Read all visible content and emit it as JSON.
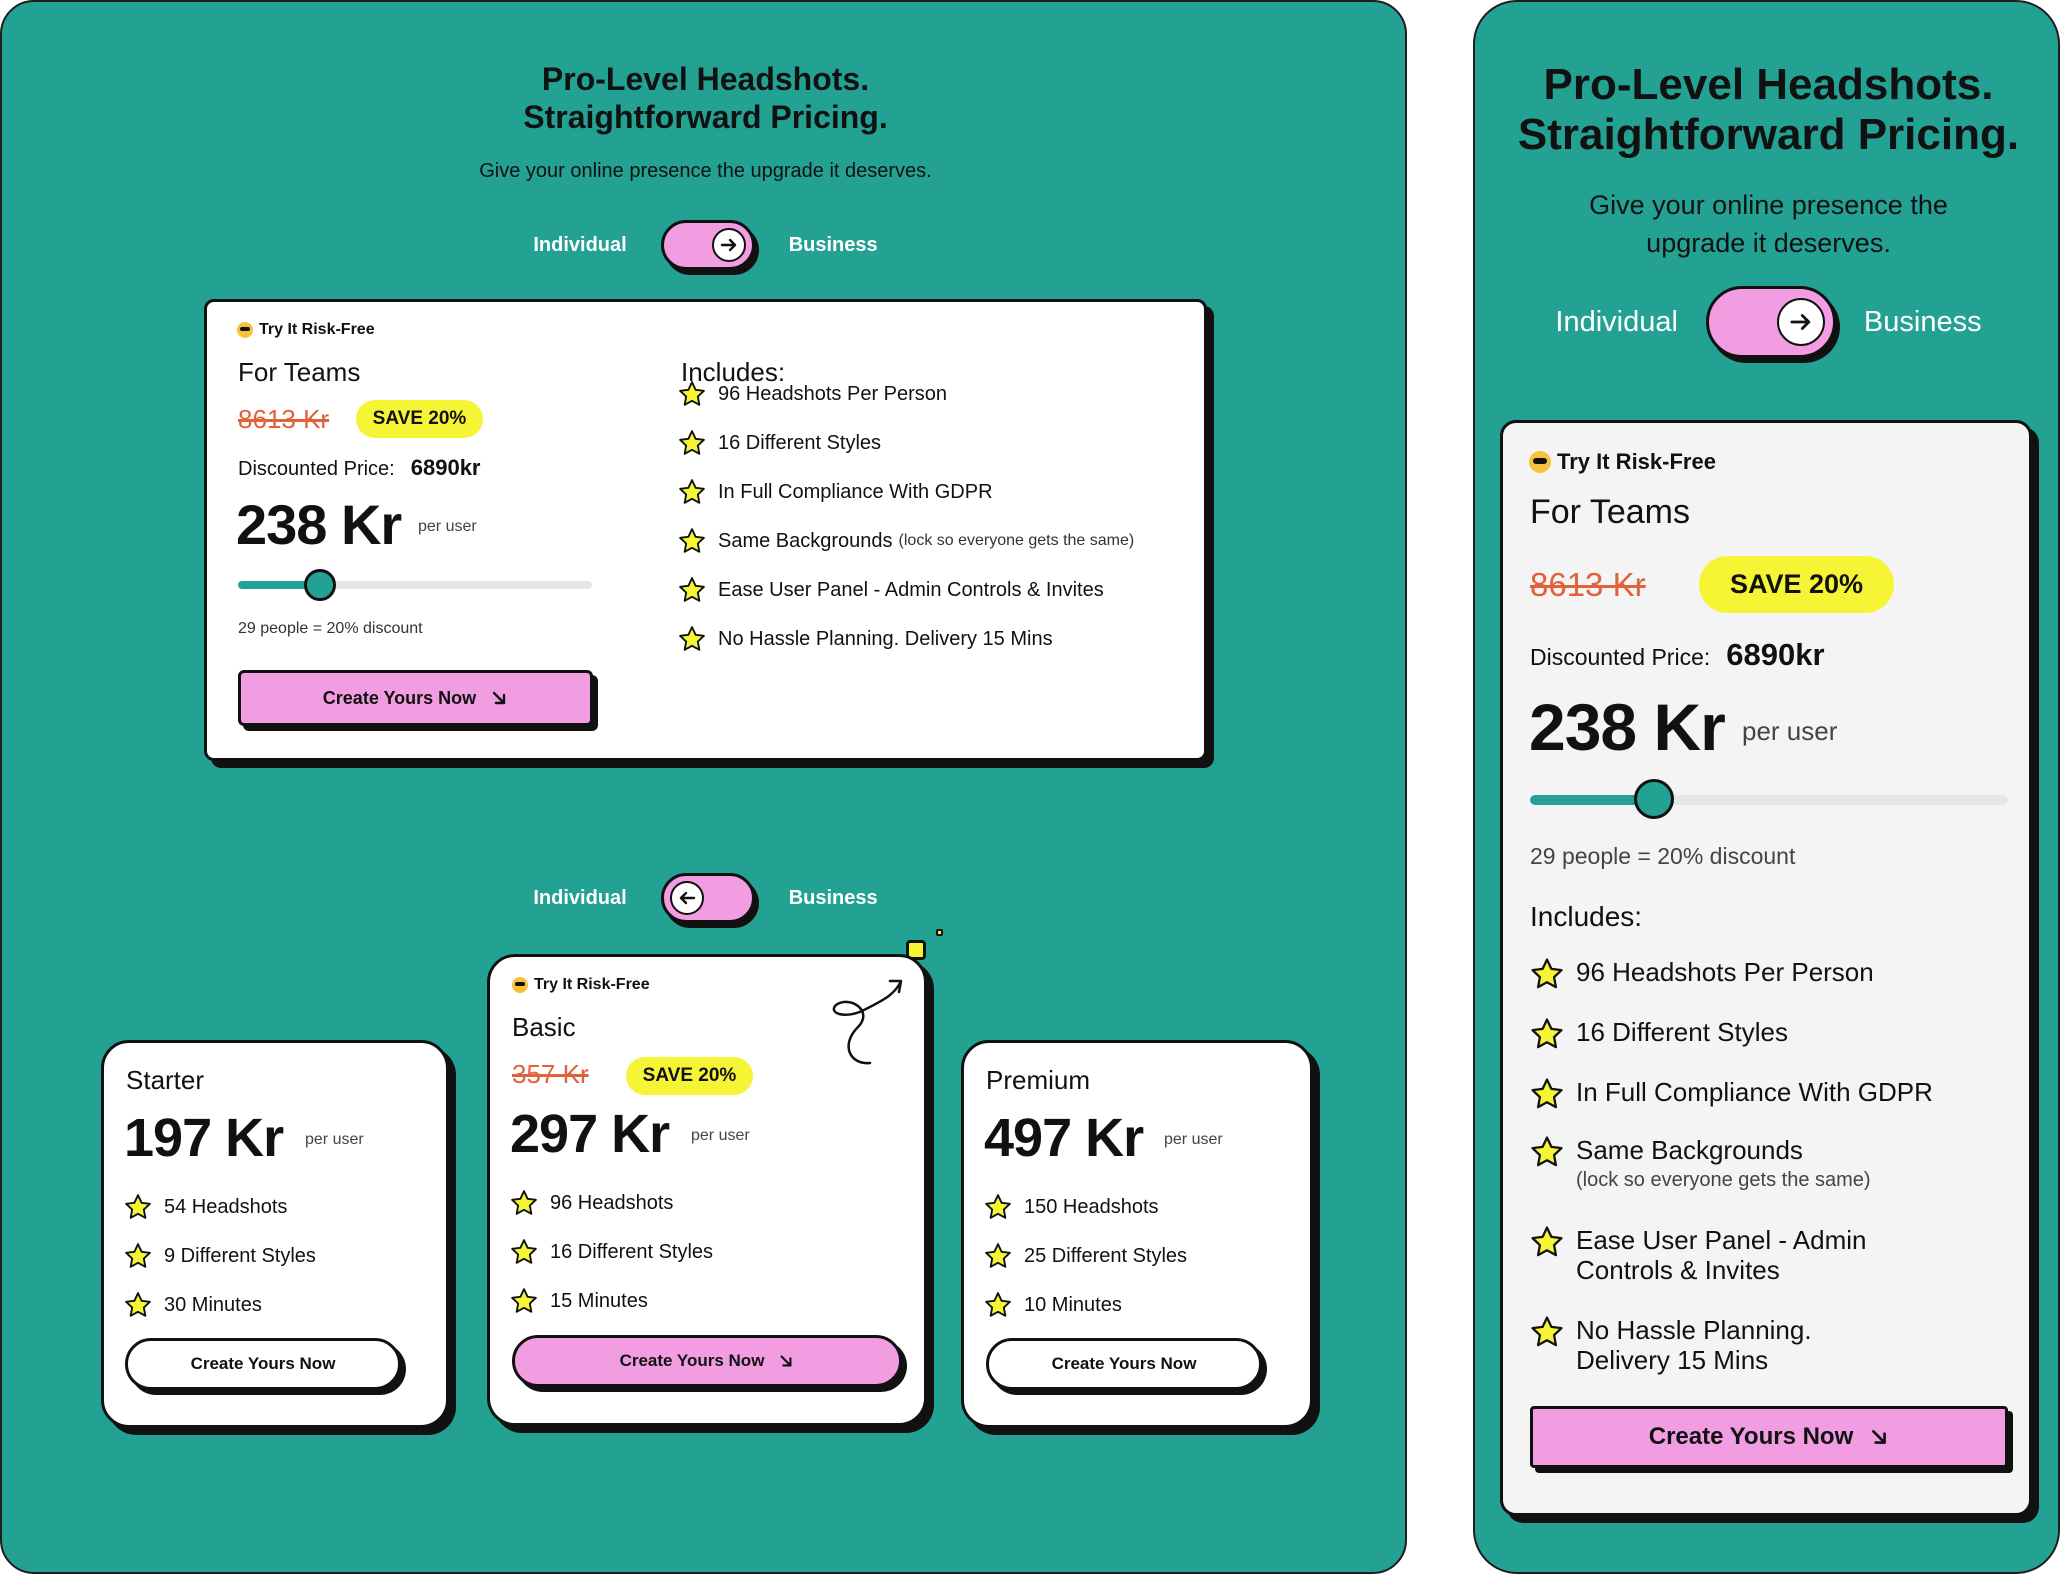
{
  "colors": {
    "teal": "#23a294",
    "pink": "#f29ce2",
    "yellow": "#f5f536",
    "strike": "#e0623c"
  },
  "hero": {
    "title_line1": "Pro-Level Headshots.",
    "title_line2": "Straightforward Pricing.",
    "subtitle": "Give your online presence the upgrade it deserves.",
    "subtitle_mobile_line1": "Give your online presence the",
    "subtitle_mobile_line2": "upgrade it deserves."
  },
  "toggle": {
    "left_label": "Individual",
    "right_label": "Business",
    "business_icon": "arrow-right-icon",
    "individual_icon": "arrow-left-icon"
  },
  "teams": {
    "risk_free": "Try It Risk-Free",
    "risk_icon": "sunglasses-emoji-icon",
    "plan_name": "For Teams",
    "old_price": "8613 Kr",
    "save_badge": "SAVE 20%",
    "discount_label": "Discounted Price:",
    "discount_value": "6890kr",
    "price": "238 Kr",
    "per_user": "per user",
    "slider_fraction": 0.23,
    "slider_caption": "29 people = 20% discount",
    "cta": "Create Yours Now",
    "includes_title": "Includes:",
    "features": [
      {
        "text": "96 Headshots Per Person",
        "note": ""
      },
      {
        "text": "16 Different Styles",
        "note": ""
      },
      {
        "text": "In Full Compliance With GDPR",
        "note": ""
      },
      {
        "text": "Same Backgrounds",
        "note": "(lock so everyone gets the same)"
      },
      {
        "text": "Ease User Panel - Admin Controls & Invites",
        "note": ""
      },
      {
        "text": "No Hassle Planning. Delivery 15 Mins",
        "note": ""
      }
    ],
    "mobile_features": [
      {
        "line1": "96 Headshots Per Person",
        "line2": ""
      },
      {
        "line1": "16 Different Styles",
        "line2": ""
      },
      {
        "line1": "In Full Compliance With GDPR",
        "line2": ""
      },
      {
        "line1": "Same Backgrounds",
        "line2": "(lock so everyone gets the same)"
      },
      {
        "line1": "Ease User Panel - Admin",
        "line2": "Controls & Invites"
      },
      {
        "line1": "No Hassle Planning.",
        "line2": "Delivery 15 Mins"
      }
    ]
  },
  "individual": {
    "plans": [
      {
        "name": "Starter",
        "price": "197 Kr",
        "per_user": "per user",
        "features": [
          "54 Headshots",
          "9 Different Styles",
          "30 Minutes"
        ],
        "cta": "Create Yours Now"
      },
      {
        "name": "Basic",
        "risk_free": "Try It Risk-Free",
        "old_price": "357 Kr",
        "save_badge": "SAVE 20%",
        "price": "297 Kr",
        "per_user": "per user",
        "features": [
          "96 Headshots",
          "16 Different Styles",
          "15 Minutes"
        ],
        "cta": "Create Yours Now"
      },
      {
        "name": "Premium",
        "price": "497 Kr",
        "per_user": "per user",
        "features": [
          "150 Headshots",
          "25 Different Styles",
          "10 Minutes"
        ],
        "cta": "Create Yours Now"
      }
    ]
  }
}
